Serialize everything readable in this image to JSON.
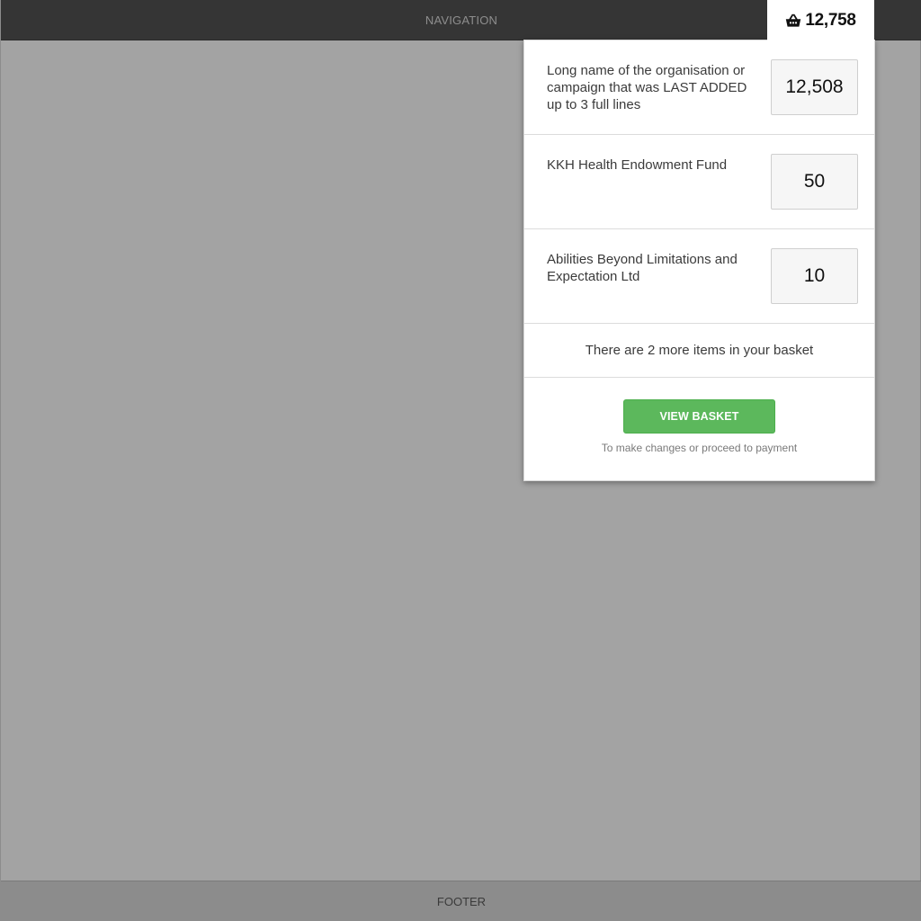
{
  "header": {
    "nav_label": "NAVIGATION",
    "basket_icon": "basket-icon",
    "basket_total": "12,758"
  },
  "basket_dropdown": {
    "items": [
      {
        "name": "Long name of the organisation or campaign that was LAST ADDED up to 3 full lines",
        "amount": "12,508"
      },
      {
        "name": "KKH Health Endowment Fund",
        "amount": "50"
      },
      {
        "name": "Abilities Beyond Limitations and Expectation Ltd",
        "amount": "10"
      }
    ],
    "more_items_text": "There are 2 more items in your basket",
    "view_basket_label": "VIEW BASKET",
    "hint_text": "To make changes or proceed to payment"
  },
  "footer": {
    "label": "FOOTER"
  },
  "colors": {
    "topbar": "#353535",
    "page_bg": "#a3a3a3",
    "footer_bg": "#8c8c8c",
    "button_green": "#5cb85c"
  }
}
